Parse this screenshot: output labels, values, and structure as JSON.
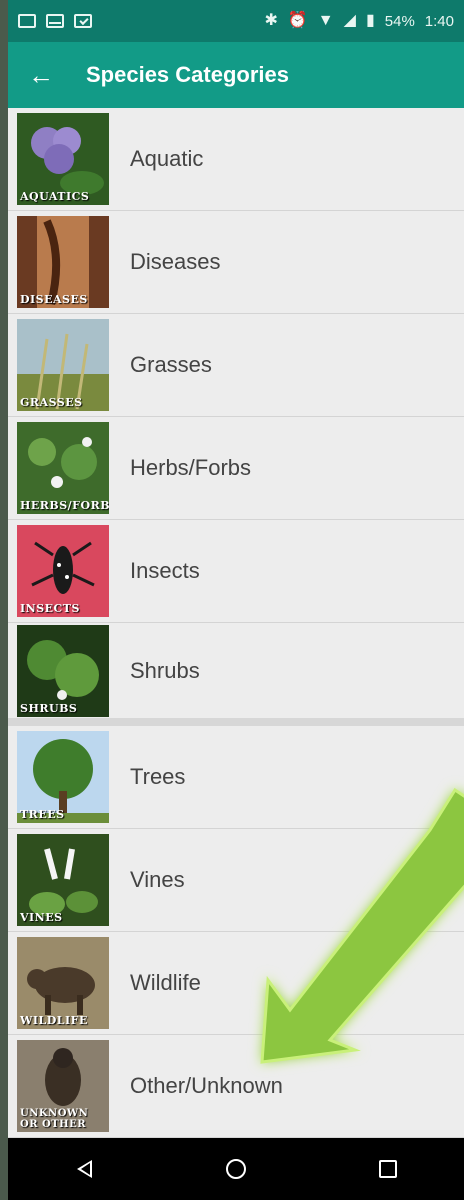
{
  "status_bar": {
    "battery": "54%",
    "time": "1:40"
  },
  "app_bar": {
    "title": "Species Categories"
  },
  "categories": [
    {
      "label": "Aquatic",
      "thumb_caption": "AQUATICS"
    },
    {
      "label": "Diseases",
      "thumb_caption": "DISEASES"
    },
    {
      "label": "Grasses",
      "thumb_caption": "GRASSES"
    },
    {
      "label": "Herbs/Forbs",
      "thumb_caption": "HERBS/FORBS"
    },
    {
      "label": "Insects",
      "thumb_caption": "INSECTS"
    },
    {
      "label": "Shrubs",
      "thumb_caption": "SHRUBS"
    },
    {
      "label": "Trees",
      "thumb_caption": "TREES"
    },
    {
      "label": "Vines",
      "thumb_caption": "VINES"
    },
    {
      "label": "Wildlife",
      "thumb_caption": "WILDLIFE"
    },
    {
      "label": "Other/Unknown",
      "thumb_caption": "UNKNOWN OR OTHER"
    }
  ],
  "colors": {
    "status_bar": "#0e7a6b",
    "app_bar": "#129b87",
    "list_bg": "#ededed",
    "annotation_arrow": "#8cc63f"
  },
  "nav_icons": [
    "back-icon",
    "home-icon",
    "recents-icon"
  ]
}
